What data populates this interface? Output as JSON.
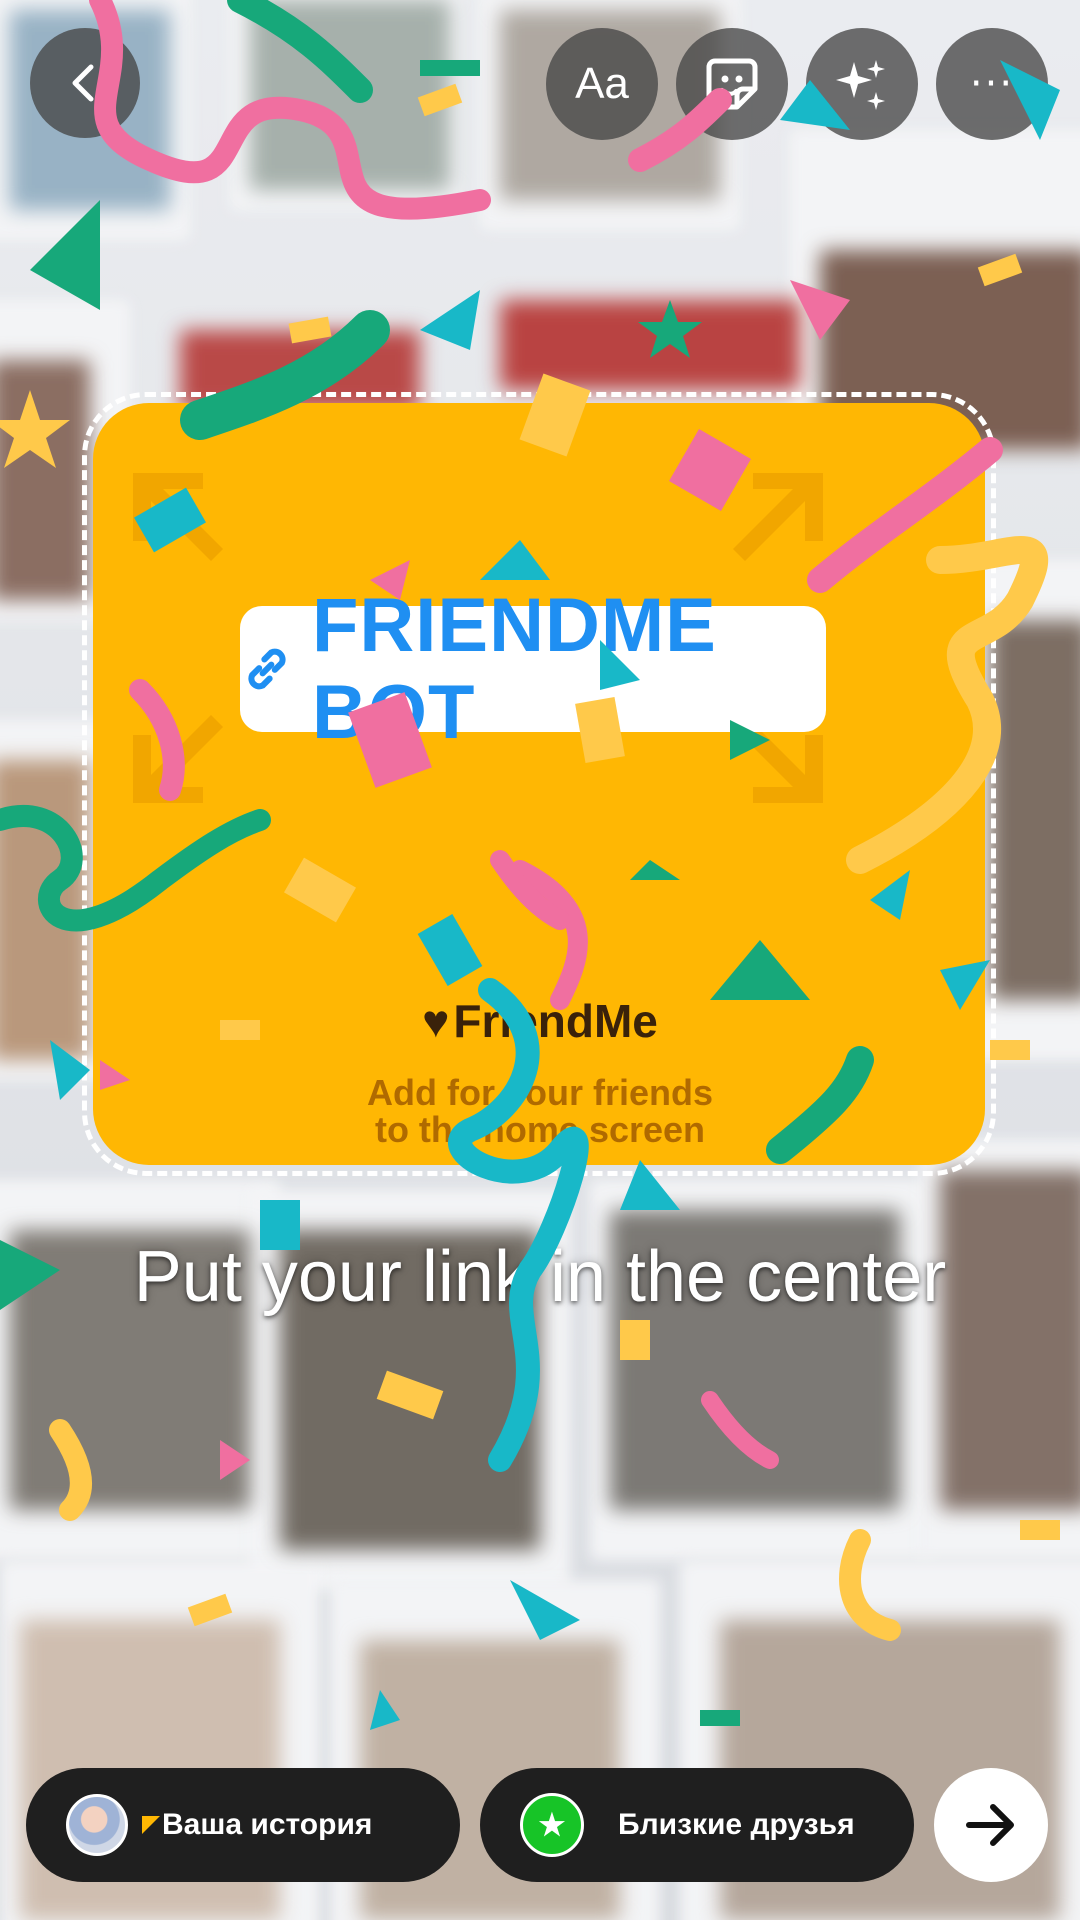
{
  "toolbar": {
    "back_icon": "chevron-left-icon",
    "text_tool_label": "Aa",
    "sticker_icon": "sticker-icon",
    "effects_icon": "sparkles-icon",
    "more_label": "···"
  },
  "sticker": {
    "link_label": "FRIENDME BOT",
    "brand_name": "FriendMe",
    "tagline_line1": "Add for your friends",
    "tagline_line2": "to the home screen",
    "background_color": "#ffb703",
    "link_color": "#1f8ff2"
  },
  "hint": "Put your link in the center",
  "bottom_bar": {
    "story_label": "Ваша история",
    "close_friends_label": "Близкие друзья",
    "close_friends_color": "#17c427"
  }
}
